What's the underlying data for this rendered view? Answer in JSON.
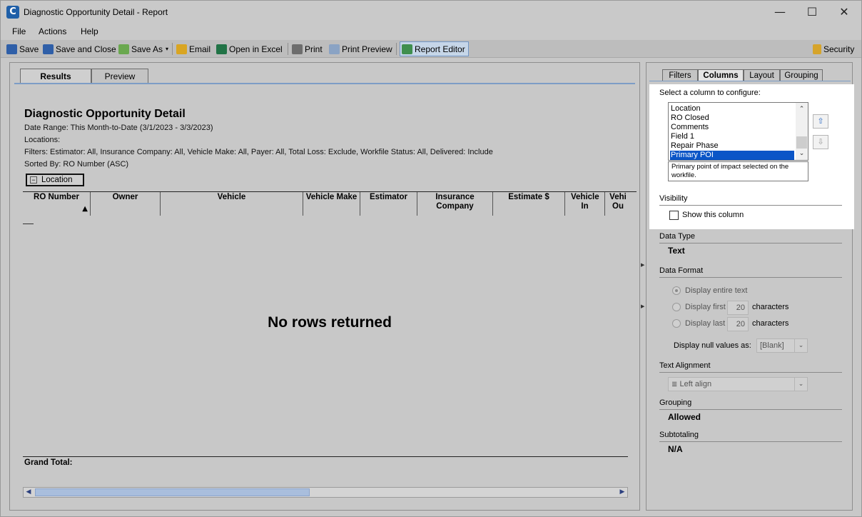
{
  "window": {
    "title": "Diagnostic Opportunity Detail - Report",
    "app_icon_letter": "C",
    "minimize": "—",
    "maximize": "☐",
    "close": "✕"
  },
  "menu": [
    "File",
    "Actions",
    "Help"
  ],
  "toolbar": {
    "save": "Save",
    "save_close": "Save and Close",
    "save_as": "Save As",
    "email": "Email",
    "open_excel": "Open in Excel",
    "print": "Print",
    "print_preview": "Print Preview",
    "report_editor": "Report Editor",
    "security": "Security"
  },
  "left_tabs": [
    "Results",
    "Preview"
  ],
  "report": {
    "title": "Diagnostic Opportunity Detail",
    "date_range": "Date Range: This Month-to-Date (3/1/2023 - 3/3/2023)",
    "locations": "Locations:",
    "filters": "Filters: Estimator: All, Insurance Company: All, Vehicle Make: All, Payer: All, Total Loss: Exclude, Workfile Status: All, Delivered: Include",
    "sorted_by": "Sorted By: RO Number (ASC)",
    "group_label": "Location",
    "columns": [
      "RO Number",
      "Owner",
      "Vehicle",
      "Vehicle Make",
      "Estimator",
      "Insurance Company",
      "Estimate $",
      "Vehicle In",
      "Vehi Ou"
    ],
    "no_rows": "No rows returned",
    "grand_total": "Grand Total:"
  },
  "right_tabs": [
    "Filters",
    "Columns",
    "Layout",
    "Grouping"
  ],
  "config": {
    "select_label": "Select a column to configure:",
    "column_list": [
      "Location",
      "RO Closed",
      "Comments",
      "Field 1",
      "Repair Phase",
      "Primary POI"
    ],
    "selected_column": "Primary POI",
    "description": "Primary point of impact selected on the workfile.",
    "visibility_label": "Visibility",
    "show_column_label": "Show this column",
    "show_column_checked": false,
    "data_type_label": "Data Type",
    "data_type_value": "Text",
    "data_format_label": "Data Format",
    "display_entire": "Display entire text",
    "display_first": "Display first",
    "display_last": "Display last",
    "first_count": "20",
    "last_count": "20",
    "characters": "characters",
    "null_label": "Display null values as:",
    "null_value": "[Blank]",
    "text_alignment_label": "Text Alignment",
    "text_alignment_value": "Left align",
    "grouping_label": "Grouping",
    "grouping_value": "Allowed",
    "subtotaling_label": "Subtotaling",
    "subtotaling_value": "N/A"
  },
  "colors": {
    "selection": "#0a55c7",
    "tab_accent": "#7d9dc6",
    "highlight_panel": "#ffffff"
  }
}
